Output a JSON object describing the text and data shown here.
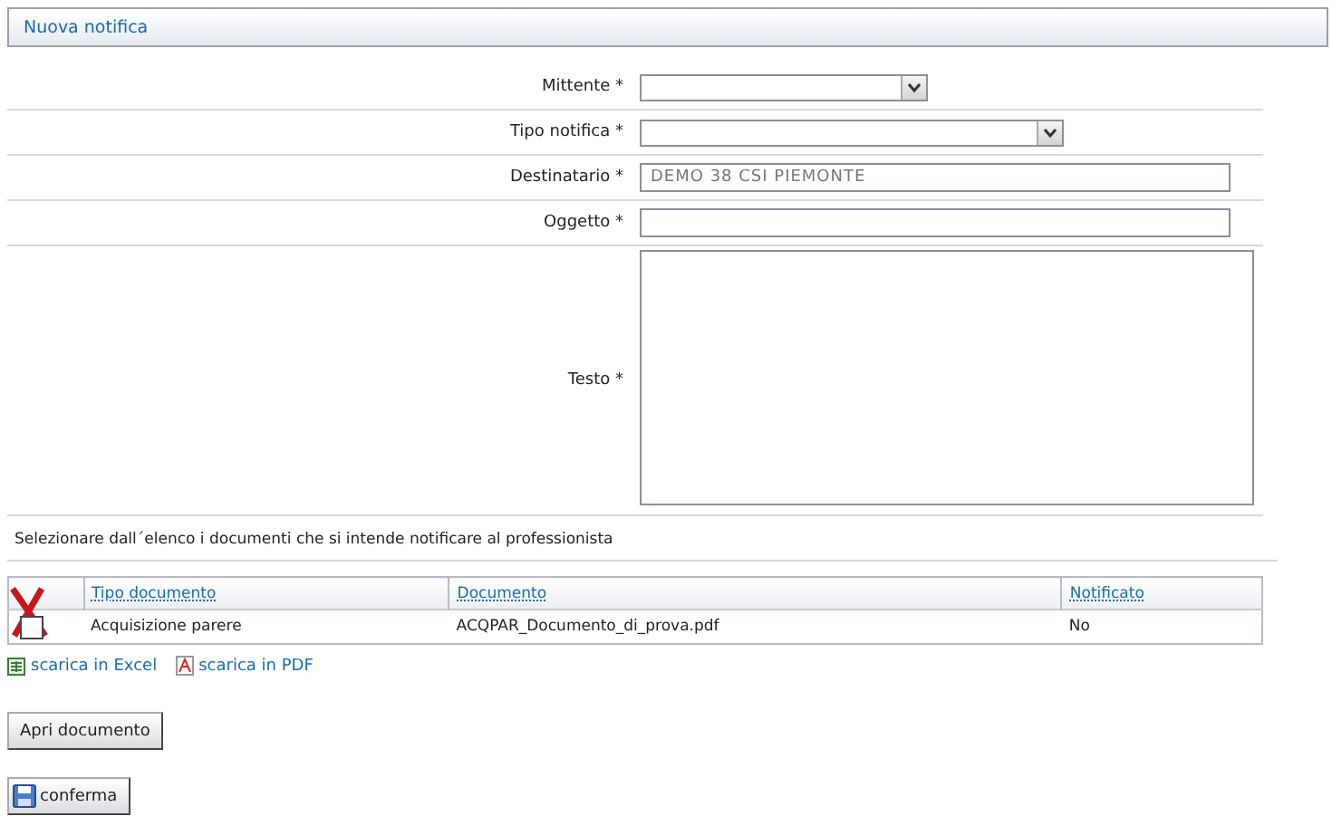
{
  "header": {
    "title": "Nuova notifica"
  },
  "form": [
    {
      "kind": "select",
      "label": "Mittente *",
      "wide": false
    },
    {
      "kind": "select",
      "label": "Tipo notifica *",
      "wide": true
    },
    {
      "kind": "input",
      "label": "Destinatario *",
      "value": "DEMO 38 CSI PIEMONTE",
      "disabled": true
    },
    {
      "kind": "input",
      "label": "Oggetto *"
    },
    {
      "kind": "textarea",
      "label": "Testo *"
    }
  ],
  "note": "Selezionare dall´elenco i documenti che si intende notificare al professionista",
  "table": {
    "columns": [
      "Tipo documento",
      "Documento",
      "Notificato"
    ],
    "rows": [
      {
        "checked": false,
        "cells": [
          "Acquisizione parere",
          "ACQPAR_Documento_di_prova.pdf",
          "No"
        ]
      }
    ]
  },
  "exports": [
    {
      "kind": "excel",
      "label": "scarica in Excel"
    },
    {
      "kind": "pdf",
      "label": "scarica in PDF"
    }
  ],
  "open_button": "Apri documento",
  "confirm_button": "conferma"
}
